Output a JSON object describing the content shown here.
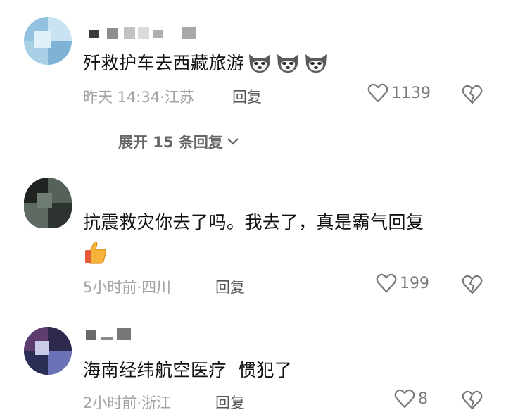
{
  "comments": [
    {
      "text": "歼救护车去西藏旅游",
      "emojis": [
        "husky-emoji",
        "husky-emoji",
        "husky-emoji"
      ],
      "time": "昨天 14:34",
      "sep": "·",
      "location": "江苏",
      "reply_label": "回复",
      "likes": "1139",
      "expand_label": "展开 15 条回复"
    },
    {
      "text": "抗震救灾你去了吗。我去了，真是霸气回复",
      "emojis": [
        "thumbs-up-emoji"
      ],
      "time": "5小时前",
      "sep": "·",
      "location": "四川",
      "reply_label": "回复",
      "likes": "199"
    },
    {
      "text": "海南经纬航空医疗  惯犯了",
      "time": "2小时前",
      "sep": "·",
      "location": "浙江",
      "reply_label": "回复",
      "likes": "8"
    }
  ],
  "icons": {
    "like": "heart-outline-icon",
    "dislike": "broken-heart-icon",
    "expand": "chevron-down-icon"
  },
  "colors": {
    "meta": "#a3a3a3",
    "text": "#111111",
    "icon": "#777777"
  }
}
